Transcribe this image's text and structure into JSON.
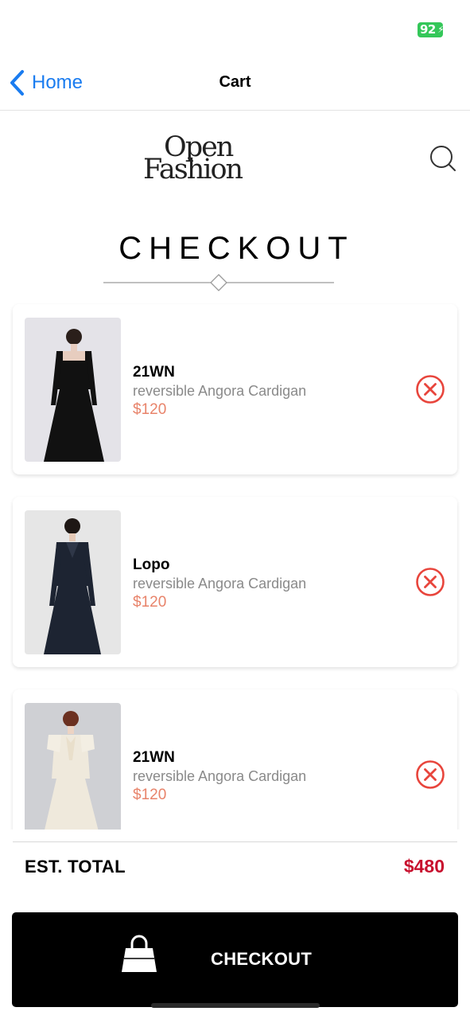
{
  "status_bar": {
    "battery_level": "92"
  },
  "nav": {
    "back_label": "Home",
    "title": "Cart"
  },
  "brand": {
    "logo_line1": "Open",
    "logo_line2": "Fashion"
  },
  "page": {
    "heading": "CHECKOUT"
  },
  "cart_items": [
    {
      "brand": "21WN",
      "description": "reversible Angora Cardigan",
      "price": "$120",
      "garment_color": "#111111"
    },
    {
      "brand": "Lopo",
      "description": "reversible Angora Cardigan",
      "price": "$120",
      "garment_color": "#1d2432"
    },
    {
      "brand": "21WN",
      "description": "reversible Angora Cardigan",
      "price": "$120",
      "garment_color": "#efe9dc"
    }
  ],
  "summary": {
    "total_label": "EST. TOTAL",
    "total_value": "$480"
  },
  "actions": {
    "checkout_label": "CHECKOUT"
  },
  "colors": {
    "accent_blue": "#1a7cf0",
    "price": "#e8836a",
    "total": "#c8102e",
    "remove": "#e8453c",
    "battery": "#34c759"
  }
}
